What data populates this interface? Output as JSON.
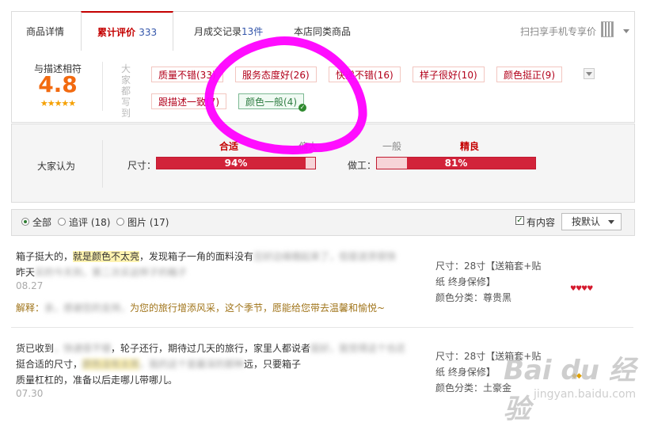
{
  "tabs": [
    {
      "label": "商品详情"
    },
    {
      "label": "累计评价",
      "count": "333"
    },
    {
      "label": "月成交记录",
      "count": "13件"
    },
    {
      "label": "本店同类商品"
    }
  ],
  "scan_text": "扫扫享手机专享价",
  "rating": {
    "label": "与描述相符",
    "score": "4.8",
    "stars": "★★★★★"
  },
  "tags_title": "大家都写到",
  "tags": [
    {
      "text": "质量不错(33)"
    },
    {
      "text": "服务态度好(26)"
    },
    {
      "text": "快递不错(16)"
    },
    {
      "text": "样子很好(10)"
    },
    {
      "text": "颜色挺正(9)"
    },
    {
      "text": "跟描述一致(7)"
    },
    {
      "text": "颜色一般(4)",
      "selected": true
    }
  ],
  "consensus": {
    "title": "大家认为",
    "bars": [
      {
        "name": "尺寸：",
        "pct_label": "94%",
        "value": 94,
        "left_label": "合适",
        "right_label": "偏大"
      },
      {
        "name": "做工：",
        "pct_label": "81%",
        "value": 81,
        "left_label": "一般",
        "right_label": "精良"
      }
    ]
  },
  "filter": {
    "options": [
      "全部",
      "追评 (18)",
      "图片 (17)"
    ],
    "has_content_label": "有内容",
    "sort_label": "按默认"
  },
  "reviews": [
    {
      "text_a": "箱子挺大的，",
      "text_hl": "就是颜色不太亮",
      "text_b": "，发现箱子一角的面料没有",
      "text_blur1": "压好边缘翘起来了，但是送货很快",
      "line2_a": "昨天",
      "text_blur2": "买的今天到，第二次买这样子的箱子",
      "date": "08.27",
      "reply_label": "解释：",
      "reply_blur": "亲，感谢您的支持，",
      "reply_text": "为您的旅行增添风采，这个季节，愿能给您带去温馨和愉悦~",
      "sku_size_a": "尺寸：28寸【送箱套+贴",
      "sku_size_b": "纸 终身保修】",
      "sku_color": "颜色分类：尊贵黑",
      "badge": "♥♥♥♥"
    },
    {
      "text_a": "货已收到",
      "text_blur1": "，快递很不错",
      "text_b": "，轮子还行，期待过几天的旅行，家里人都说者",
      "text_blur2": "挺好，我觉得这个也还",
      "line2_a": "挺合适的尺寸，",
      "text_hl": "颜色没有太亮",
      "text_blur3": "，我的这个是最深的那种",
      "line2_b": "远，只要箱子",
      "line3": "质量杠杠的，准备以后走哪儿带哪儿。",
      "date": "07.30",
      "sku_size_a": "尺寸：28寸【送箱套+贴",
      "sku_size_b": "纸 终身保修】",
      "sku_color": "颜色分类：土豪金",
      "badge": "◆◆"
    }
  ],
  "watermark": {
    "brand": "Bai du 经验",
    "url": "jingyan.baidu.com"
  }
}
